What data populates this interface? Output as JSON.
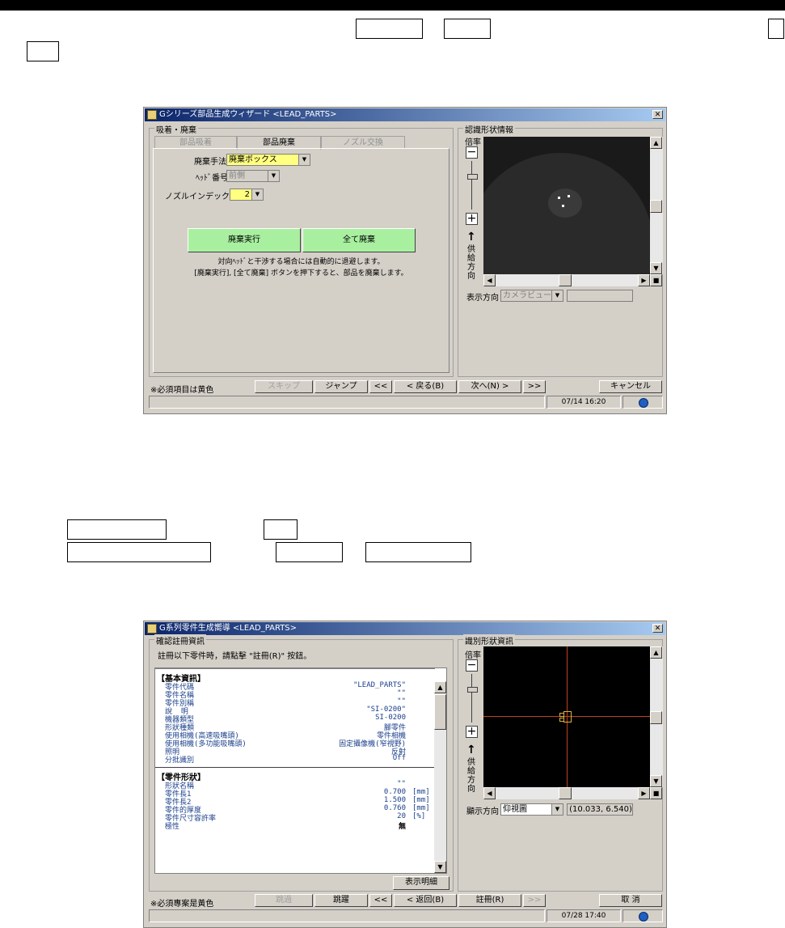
{
  "window1": {
    "title": "Gシリーズ部品生成ウィザード <LEAD_PARTS>",
    "group_label": "吸着・廃棄",
    "tabs": [
      "部品吸着",
      "部品廃棄",
      "ノズル交換"
    ],
    "active_tab": 1,
    "disposal_method_label": "廃棄手法",
    "disposal_method_value": "廃棄ボックス",
    "head_number_label": "ﾍｯﾄﾞ番号",
    "head_number_value": "前側",
    "nozzle_index_label": "ノズルインデックス",
    "nozzle_index_value": "2",
    "execute_disposal": "廃棄実行",
    "dispose_all": "全て廃棄",
    "note_line1": "対向ﾍｯﾄﾞと干渉する場合には自動的に退避します。",
    "note_line2": "[廃棄実行], [全て廃棄] ボタンを押下すると、部品を廃棄します。",
    "shape_group_label": "認識形状情報",
    "zoom_label": "倍率",
    "feed_dir_chars": [
      "供",
      "給",
      "方",
      "向"
    ],
    "view_dir_label": "表示方向",
    "view_dir_value": "カメラビュー",
    "required_note": "※必須項目は黄色",
    "buttons": {
      "skip": "スキップ",
      "jump": "ジャンプ",
      "first": "<<",
      "back": "< 戻る(B)",
      "next": "次へ(N) >",
      "last": ">>",
      "cancel": "キャンセル"
    },
    "datetime": "07/14 16:20"
  },
  "window2": {
    "title": "G系列零件生成嚮導 <LEAD_PARTS>",
    "group_label": "確認註冊資訊",
    "instruction": "註冊以下零件時，請點擊 \"註冊(R)\" 按鈕。",
    "sections": [
      {
        "header": "【基本資訊】",
        "rows": [
          {
            "k": "零件代碼",
            "v": "\"LEAD_PARTS\"",
            "u": ""
          },
          {
            "k": "零件名稱",
            "v": "\"\"",
            "u": ""
          },
          {
            "k": "零件別稱",
            "v": "\"\"",
            "u": ""
          },
          {
            "k": "說  明",
            "v": "\"SI-0200\"",
            "u": ""
          },
          {
            "k": "機器類型",
            "v": "SI-0200",
            "u": ""
          },
          {
            "k": "形狀種類",
            "v": "腳零件",
            "u": ""
          },
          {
            "k": "使用相機(高速吸嘴頭)",
            "v": "零件相機",
            "u": ""
          },
          {
            "k": "使用相機(多功能吸嘴頭)",
            "v": "固定攝像機(窄視野)",
            "u": ""
          },
          {
            "k": "照明",
            "v": "反射",
            "u": ""
          },
          {
            "k": "分批識別",
            "v": "Off",
            "u": ""
          }
        ]
      },
      {
        "header": "【零件形狀】",
        "rows": [
          {
            "k": "形狀名稱",
            "v": "\"\"",
            "u": ""
          },
          {
            "k": "零件長1",
            "v": "0.700",
            "u": "[mm]"
          },
          {
            "k": "零件長2",
            "v": "1.500",
            "u": "[mm]"
          },
          {
            "k": "零件的厚度",
            "v": "0.760",
            "u": "[mm]"
          },
          {
            "k": "零件尺寸容許率",
            "v": "20",
            "u": "[%]"
          },
          {
            "k": "極性",
            "v": "無",
            "u": ""
          }
        ]
      }
    ],
    "show_detail": "表示明細",
    "shape_group_label": "識別形狀資訊",
    "zoom_label": "倍率",
    "feed_dir_chars": [
      "供",
      "給",
      "方",
      "向"
    ],
    "view_dir_label": "顯示方向",
    "view_dir_value": "仰視圖",
    "coord_readout": "(10.033, 6.540)",
    "required_note": "※必須專案是黃色",
    "buttons": {
      "skip": "跳過",
      "jump": "跳躍",
      "first": "<<",
      "back": "< 返回(B)",
      "register": "註冊(R)",
      "last": ">>",
      "cancel": "取 消"
    },
    "datetime": "07/28 17:40"
  },
  "colors": {
    "titlebar": "#0a246a",
    "required_yellow": "#ffff80",
    "action_green": "#a8f0a0",
    "crosshair": "#c04020"
  }
}
